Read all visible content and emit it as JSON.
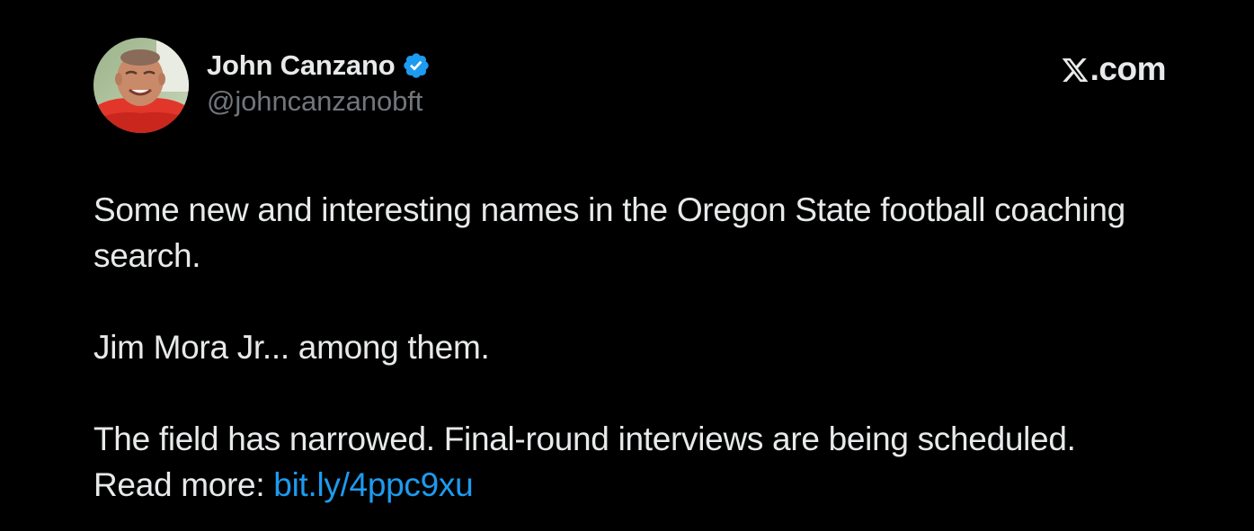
{
  "author": {
    "name": "John Canzano",
    "handle": "@johncanzanobft",
    "verified": true,
    "avatar_icon": "person-photo-avatar"
  },
  "brand": {
    "label": ".com",
    "icon": "x-logo-icon"
  },
  "tweet": {
    "paragraphs": [
      {
        "text": "Some new and interesting names in the Oregon State football coaching search."
      },
      {
        "text": "Jim Mora Jr... among them."
      },
      {
        "line1": "The field has narrowed. Final-round interviews are being scheduled.",
        "read_more_label": "Read more: ",
        "link_text": "bit.ly/4ppc9xu"
      }
    ]
  },
  "colors": {
    "background": "#000000",
    "text": "#e7e9ea",
    "secondary": "#71767b",
    "accent": "#1d9bf0"
  }
}
